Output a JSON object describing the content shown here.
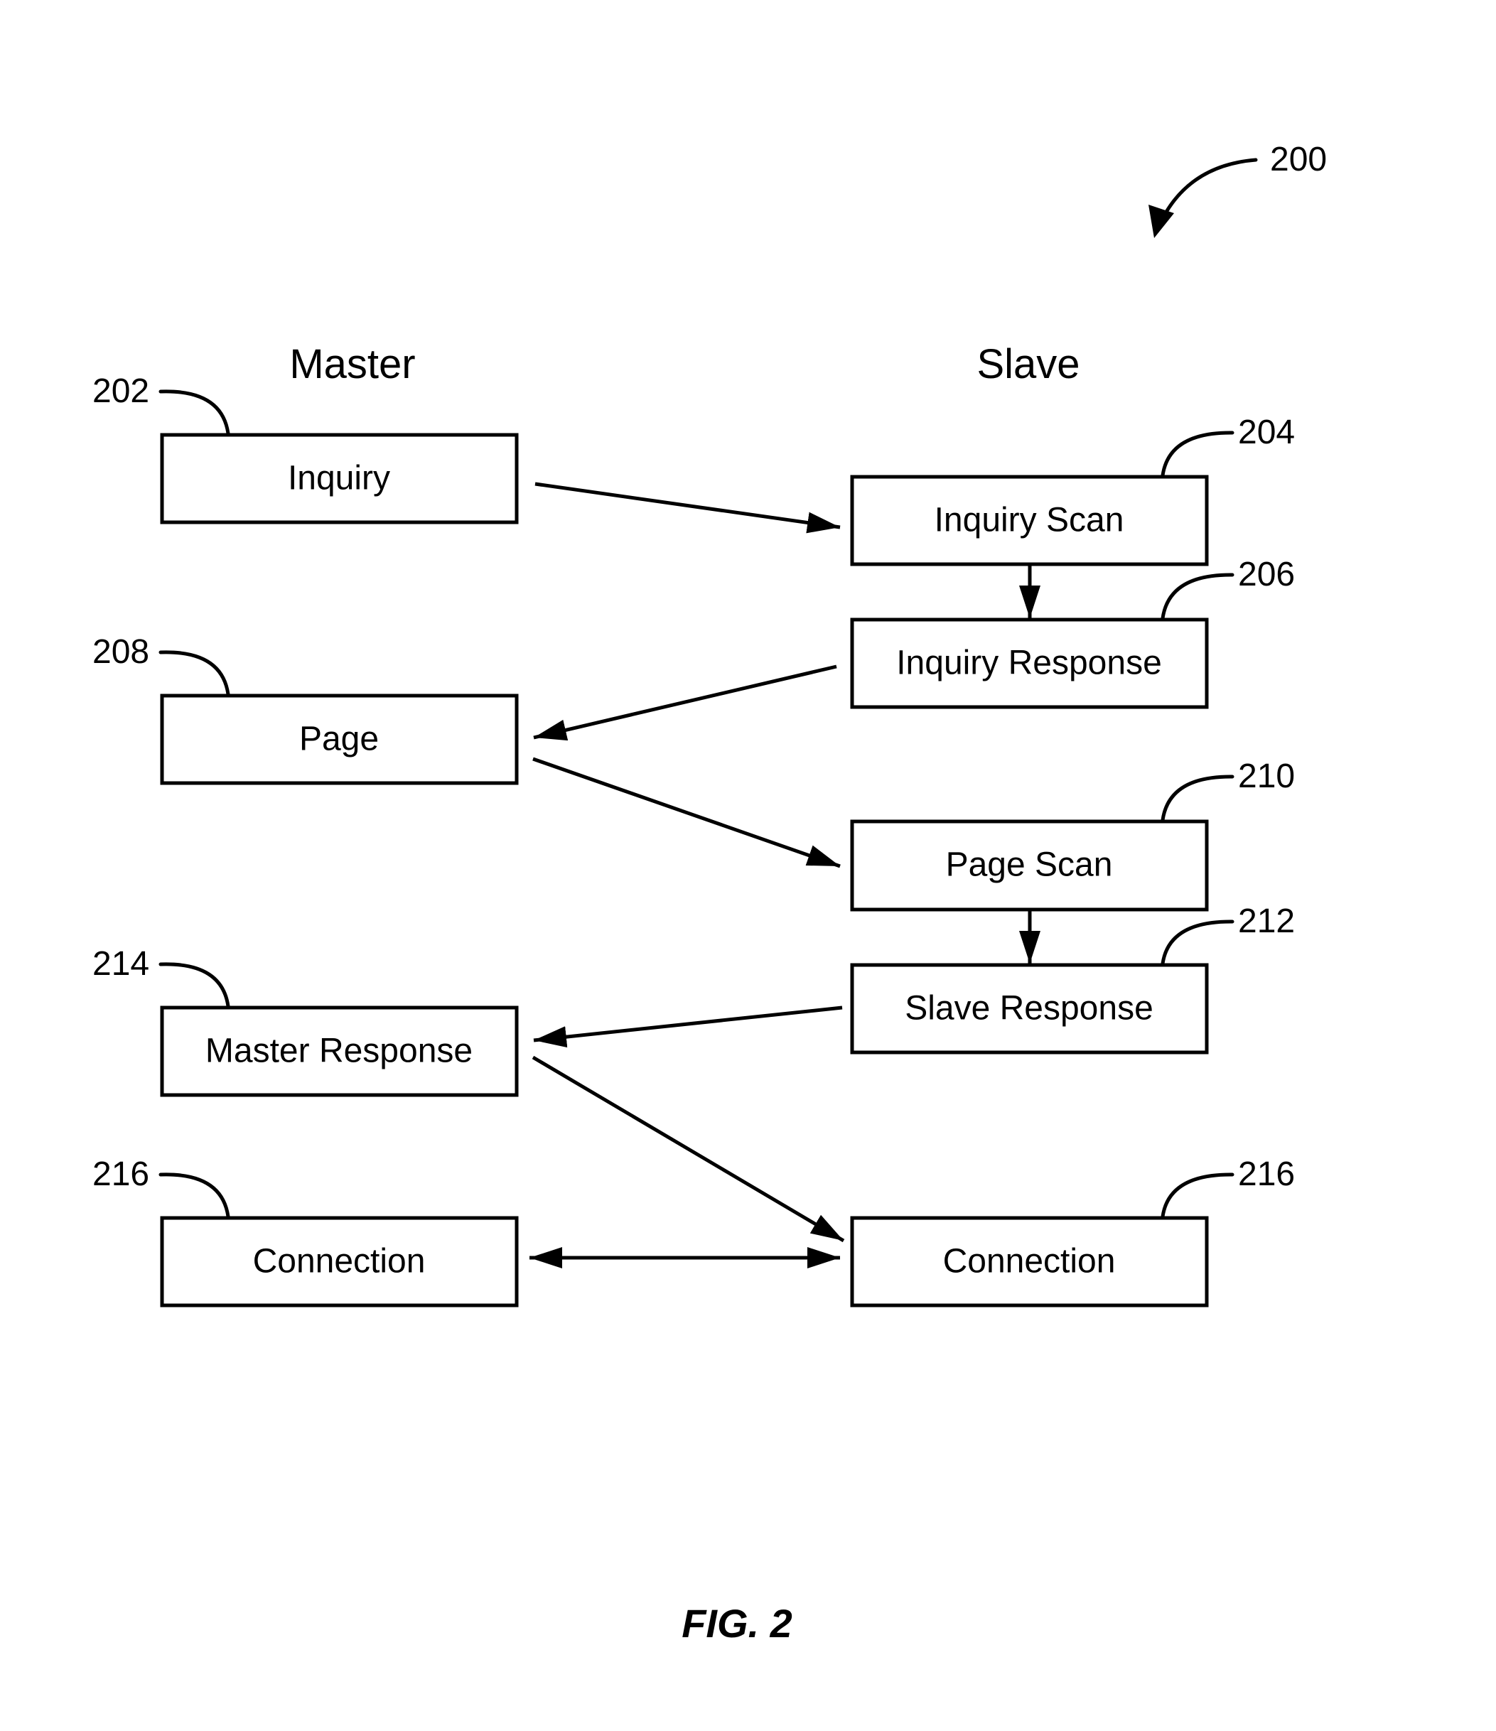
{
  "figure": {
    "ref": "200",
    "caption": "FIG. 2"
  },
  "columns": {
    "master": "Master",
    "slave": "Slave"
  },
  "boxes": {
    "inquiry": {
      "label": "Inquiry",
      "ref": "202"
    },
    "inquiry_scan": {
      "label": "Inquiry Scan",
      "ref": "204"
    },
    "inquiry_response": {
      "label": "Inquiry Response",
      "ref": "206"
    },
    "page": {
      "label": "Page",
      "ref": "208"
    },
    "page_scan": {
      "label": "Page Scan",
      "ref": "210"
    },
    "slave_response": {
      "label": "Slave Response",
      "ref": "212"
    },
    "master_response": {
      "label": "Master Response",
      "ref": "214"
    },
    "connection_master": {
      "label": "Connection",
      "ref": "216"
    },
    "connection_slave": {
      "label": "Connection",
      "ref": "216"
    }
  },
  "flows": [
    {
      "from": "inquiry",
      "to": "inquiry_scan"
    },
    {
      "from": "inquiry_scan",
      "to": "inquiry_response"
    },
    {
      "from": "inquiry_response",
      "to": "page"
    },
    {
      "from": "page",
      "to": "page_scan"
    },
    {
      "from": "page_scan",
      "to": "slave_response"
    },
    {
      "from": "slave_response",
      "to": "master_response"
    },
    {
      "from": "master_response",
      "to": "connection_slave"
    },
    {
      "from": "connection_master",
      "to": "connection_slave",
      "bidirectional": true
    }
  ]
}
